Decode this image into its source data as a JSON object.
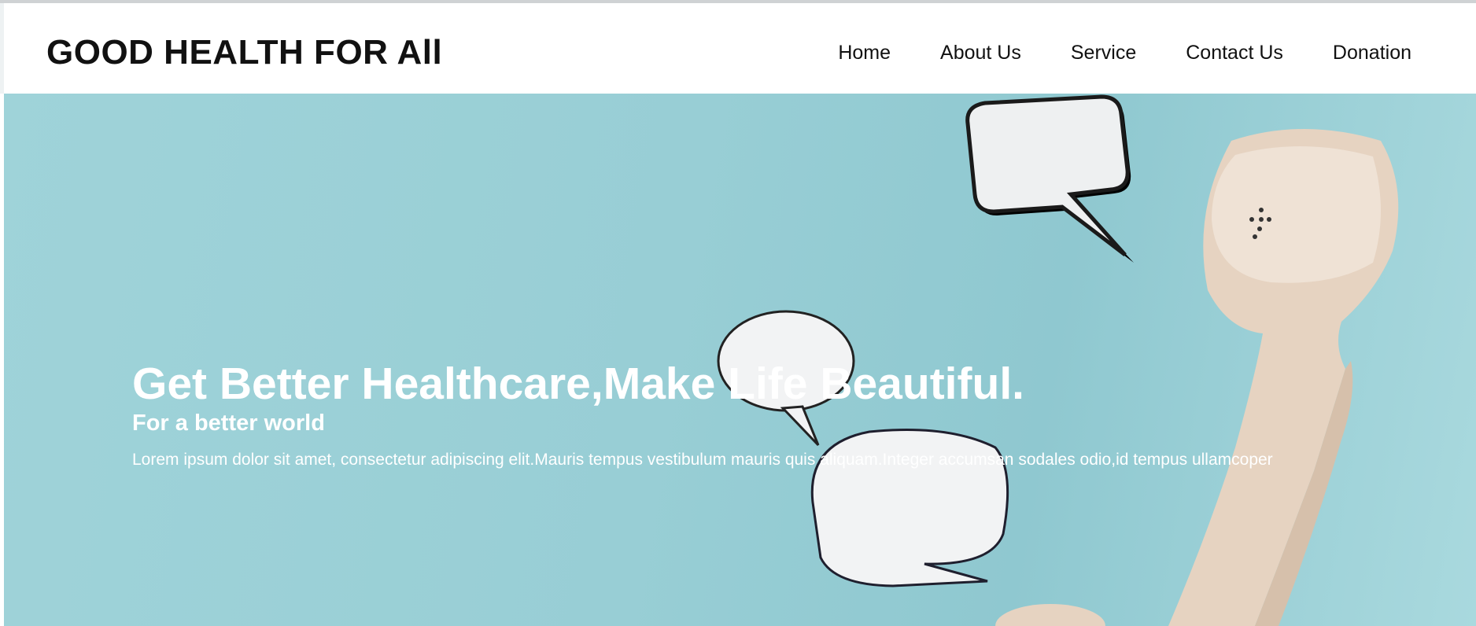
{
  "brand": {
    "title": "GOOD HEALTH FOR All"
  },
  "nav": {
    "items": [
      {
        "label": "Home"
      },
      {
        "label": "About Us"
      },
      {
        "label": "Service"
      },
      {
        "label": "Contact Us"
      },
      {
        "label": "Donation"
      }
    ]
  },
  "hero": {
    "title": "Get Better Healthcare,Make Life Beautiful.",
    "subtitle": "For a better world",
    "body": "Lorem ipsum dolor sit amet, consectetur adipiscing elit.Mauris tempus vestibulum mauris quis aliquam.Integer accumsan sodales odio,id tempus ullamcoper"
  },
  "colors": {
    "hero_background": "#98ced5",
    "text_dark": "#111111",
    "text_light": "#ffffff",
    "handset": "#e7d5c4"
  },
  "icons": [
    "speech-bubble-icon",
    "telephone-handset-icon"
  ]
}
